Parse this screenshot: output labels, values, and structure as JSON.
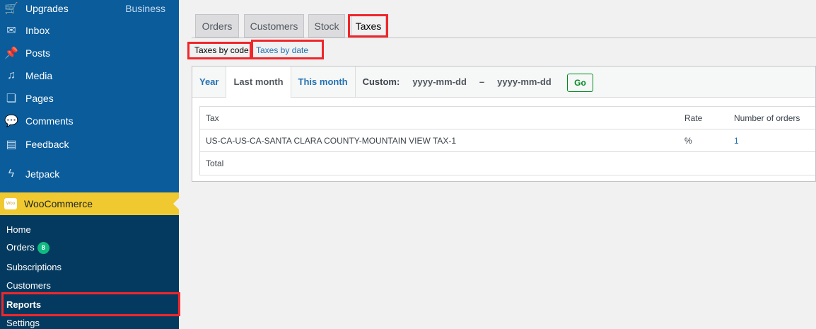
{
  "sidebar": {
    "items": [
      {
        "label": "Upgrades",
        "extra": "Business",
        "icon": "cart-icon"
      },
      {
        "label": "Inbox",
        "icon": "mail-icon"
      },
      {
        "label": "Posts",
        "icon": "pin-icon"
      },
      {
        "label": "Media",
        "icon": "media-icon"
      },
      {
        "label": "Pages",
        "icon": "pages-icon"
      },
      {
        "label": "Comments",
        "icon": "comment-icon"
      },
      {
        "label": "Feedback",
        "icon": "feedback-icon"
      },
      {
        "label": "Jetpack",
        "icon": "jetpack-icon"
      }
    ],
    "woo": {
      "label": "WooCommerce",
      "logo": "Woo"
    },
    "submenu": [
      {
        "label": "Home"
      },
      {
        "label": "Orders",
        "badge": "8"
      },
      {
        "label": "Subscriptions"
      },
      {
        "label": "Customers"
      },
      {
        "label": "Reports"
      },
      {
        "label": "Settings"
      }
    ]
  },
  "tabs": [
    "Orders",
    "Customers",
    "Stock",
    "Taxes"
  ],
  "subnav": {
    "by_code": "Taxes by code",
    "by_date": "Taxes by date"
  },
  "ranges": {
    "year": "Year",
    "last_month": "Last month",
    "this_month": "This month",
    "custom": "Custom:",
    "from": "yyyy-mm-dd",
    "dash": "–",
    "to": "yyyy-mm-dd",
    "go": "Go"
  },
  "table": {
    "headers": [
      "Tax",
      "Rate",
      "Number of orders"
    ],
    "rows": [
      [
        "US-CA-US-CA-SANTA CLARA COUNTY-MOUNTAIN VIEW TAX-1",
        "%",
        "1"
      ]
    ],
    "total": "Total"
  }
}
